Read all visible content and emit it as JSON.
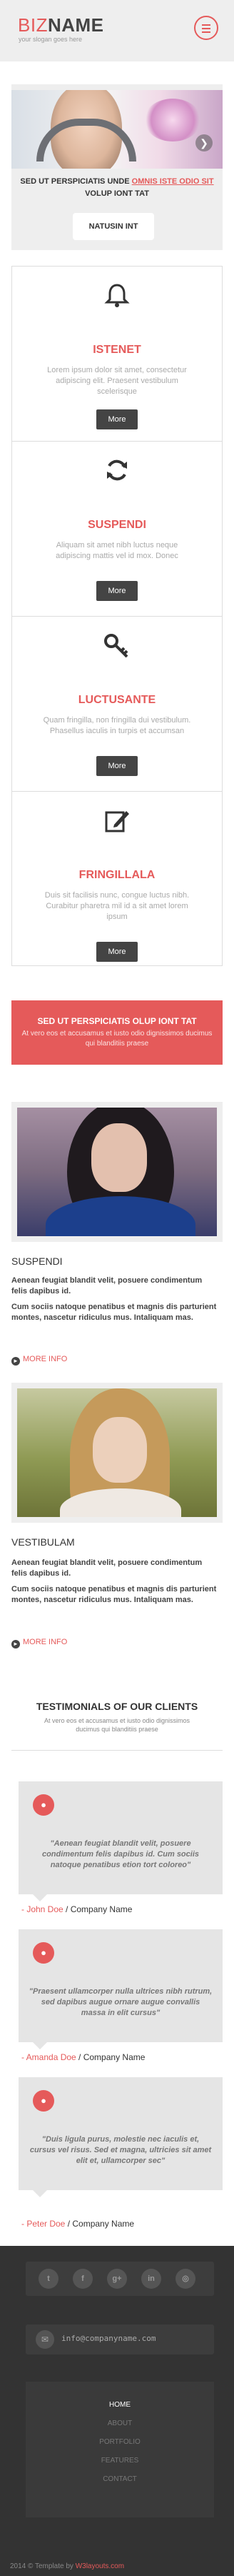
{
  "header": {
    "logo_light": "BIZ",
    "logo_bold": "NAME",
    "tagline": "your slogan goes here"
  },
  "slider": {
    "caption_prefix": "SED UT PERSPICIATIS UNDE ",
    "caption_link": "OMNIS ISTE ODIO SIT",
    "caption_suffix": " VOLUP IONT TAT",
    "button": "NATUSIN INT",
    "next_symbol": "❯"
  },
  "features": [
    {
      "icon": "bell-icon",
      "title": "ISTENET",
      "text": "Lorem ipsum dolor sit amet, consectetur adipiscing elit. Praesent vestibulum scelerisque",
      "more": "More"
    },
    {
      "icon": "refresh-icon",
      "title": "SUSPENDI",
      "text": "Aliquam sit amet nibh luctus neque adipiscing mattis vel id mox. Donec",
      "more": "More"
    },
    {
      "icon": "key-icon",
      "title": "LUCTUSANTE",
      "text": "Quam fringilla, non fringilla dui vestibulum. Phasellus iaculis in turpis et accumsan",
      "more": "More"
    },
    {
      "icon": "edit-icon",
      "title": "FRINGILLALA",
      "text": "Duis sit facilisis nunc, congue luctus nibh. Curabitur pharetra mil id a sit amet lorem ipsum",
      "more": "More"
    }
  ],
  "cta": {
    "title": "SED UT PERSPICIATIS OLUP IONT TAT",
    "text": "At vero eos et accusamus et iusto odio dignissimos ducimus qui blanditiis praese"
  },
  "posts": [
    {
      "title": "SUSPENDI",
      "text1": "Aenean feugiat blandit velit, posuere condimentum felis dapibus id.",
      "text2": "Cum sociis natoque penatibus et magnis dis parturient montes, nascetur ridiculus mus. Intaliquam mas.",
      "more": "MORE INFO"
    },
    {
      "title": "VESTIBULAM",
      "text1": "Aenean feugiat blandit velit, posuere condimentum felis dapibus id.",
      "text2": "Cum sociis natoque penatibus et magnis dis parturient montes, nascetur ridiculus mus. Intaliquam mas.",
      "more": "MORE INFO"
    }
  ],
  "testimonials": {
    "title": "TESTIMONIALS OF OUR CLIENTS",
    "subtitle": "At vero eos et accusamus et iusto odio dignissimos ducimus qui blanditiis praese",
    "items": [
      {
        "quote": "\"Aenean feugiat blandit velit, posuere condimentum felis dapibus id. Cum sociis natoque penatibus etion tort coloreo\"",
        "name": "- John Doe",
        "company": " / Company Name"
      },
      {
        "quote": "\"Praesent ullamcorper nulla ultrices nibh rutrum, sed dapibus augue ornare augue convallis massa in elit cursus\"",
        "name": "- Amanda Doe",
        "company": " / Company Name"
      },
      {
        "quote": "\"Duis ligula purus, molestie nec iaculis et, cursus vel risus. Sed et magna, ultricies sit amet elit et, ullamcorper sec\"",
        "name": "- Peter Doe",
        "company": " / Company Name"
      }
    ]
  },
  "footer": {
    "social": [
      "t",
      "f",
      "g+",
      "in",
      "◎"
    ],
    "email": "info@companyname.com",
    "nav": [
      "HOME",
      "ABOUT",
      "PORTFOLIO",
      "FEATURES",
      "CONTACT"
    ],
    "copyright_prefix": "2014 © Template by ",
    "copyright_brand": "W3layouts.com"
  },
  "colors": {
    "accent": "#e55a5a",
    "dark": "#333333",
    "light_gray": "#eeeeee"
  }
}
